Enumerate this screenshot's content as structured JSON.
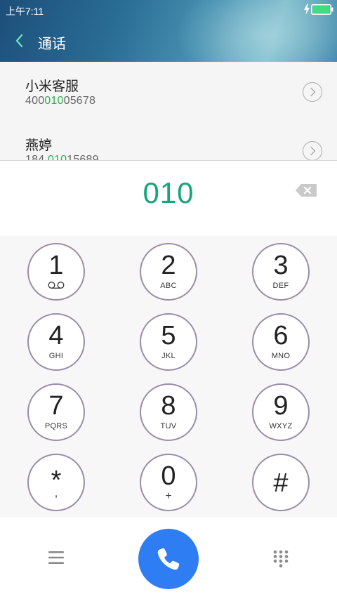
{
  "status_bar": {
    "time": "上午7:11"
  },
  "header": {
    "title": "通话"
  },
  "results": [
    {
      "name": "小米客服",
      "number_before": "400",
      "number_match": "010",
      "number_after": "05678"
    },
    {
      "name": "燕婷",
      "number_before": "184 ",
      "number_match": "010",
      "number_after": "15689"
    }
  ],
  "input": {
    "dialed": "010"
  },
  "keys": [
    {
      "digit": "1",
      "letters": ""
    },
    {
      "digit": "2",
      "letters": "ABC"
    },
    {
      "digit": "3",
      "letters": "DEF"
    },
    {
      "digit": "4",
      "letters": "GHI"
    },
    {
      "digit": "5",
      "letters": "JKL"
    },
    {
      "digit": "6",
      "letters": "MNO"
    },
    {
      "digit": "7",
      "letters": "PQRS"
    },
    {
      "digit": "8",
      "letters": "TUV"
    },
    {
      "digit": "9",
      "letters": "WXYZ"
    },
    {
      "digit": "*",
      "sub": ","
    },
    {
      "digit": "0",
      "sub": "+"
    },
    {
      "digit": "#",
      "sub": ""
    }
  ],
  "icons": {
    "back": "chevron-left-icon",
    "detail": "chevron-right-circle-icon",
    "backspace": "backspace-icon",
    "voicemail": "voicemail-icon",
    "menu": "menu-icon",
    "call": "phone-icon",
    "keypad": "keypad-icon"
  },
  "colors": {
    "accent_green": "#13a876",
    "match_green": "#2cb24f",
    "call_blue": "#2f7df3",
    "key_border": "#9a8da8",
    "back_arrow": "#6fe0b8"
  }
}
